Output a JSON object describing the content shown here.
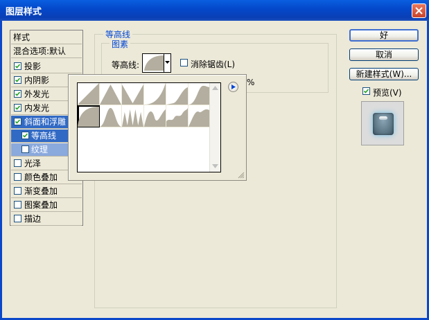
{
  "window": {
    "title": "图层样式"
  },
  "style_list": {
    "header": "样式",
    "blend": "混合选项:默认",
    "items": [
      {
        "label": "投影",
        "checked": true
      },
      {
        "label": "内阴影",
        "checked": true
      },
      {
        "label": "外发光",
        "checked": true
      },
      {
        "label": "内发光",
        "checked": true
      },
      {
        "label": "斜面和浮雕",
        "checked": true
      },
      {
        "label": "等高线",
        "checked": true
      },
      {
        "label": "纹理",
        "checked": false
      },
      {
        "label": "光泽",
        "checked": false
      },
      {
        "label": "颜色叠加",
        "checked": false
      },
      {
        "label": "渐变叠加",
        "checked": false
      },
      {
        "label": "图案叠加",
        "checked": false
      },
      {
        "label": "描边",
        "checked": false
      }
    ]
  },
  "buttons": {
    "ok": "好",
    "cancel": "取消",
    "new_style": "新建样式(W)...",
    "preview": "预览(V)",
    "preview_checked": true
  },
  "contour_panel": {
    "group_title": "等高线",
    "subgroup_title": "图素",
    "contour_label": "等高线:",
    "anti_alias": "消除锯齿(L)",
    "anti_alias_checked": false,
    "range_unit": "%"
  },
  "contour_picker": {
    "presets": [
      "linear",
      "cone",
      "cone-inverted",
      "cove-deep",
      "cove-shallow",
      "gaussian",
      "half-round",
      "ring",
      "ring-double",
      "rolling-slope",
      "rounded-steps",
      "sawtooth",
      "peaks"
    ],
    "selected": "half-round"
  },
  "colors": {
    "title_bar": "#0a4fd0",
    "selection": "#316ac5",
    "selection_light": "#8aa9dd",
    "legend_text": "#0046d5",
    "contour_fill": "#b3ae9f"
  }
}
